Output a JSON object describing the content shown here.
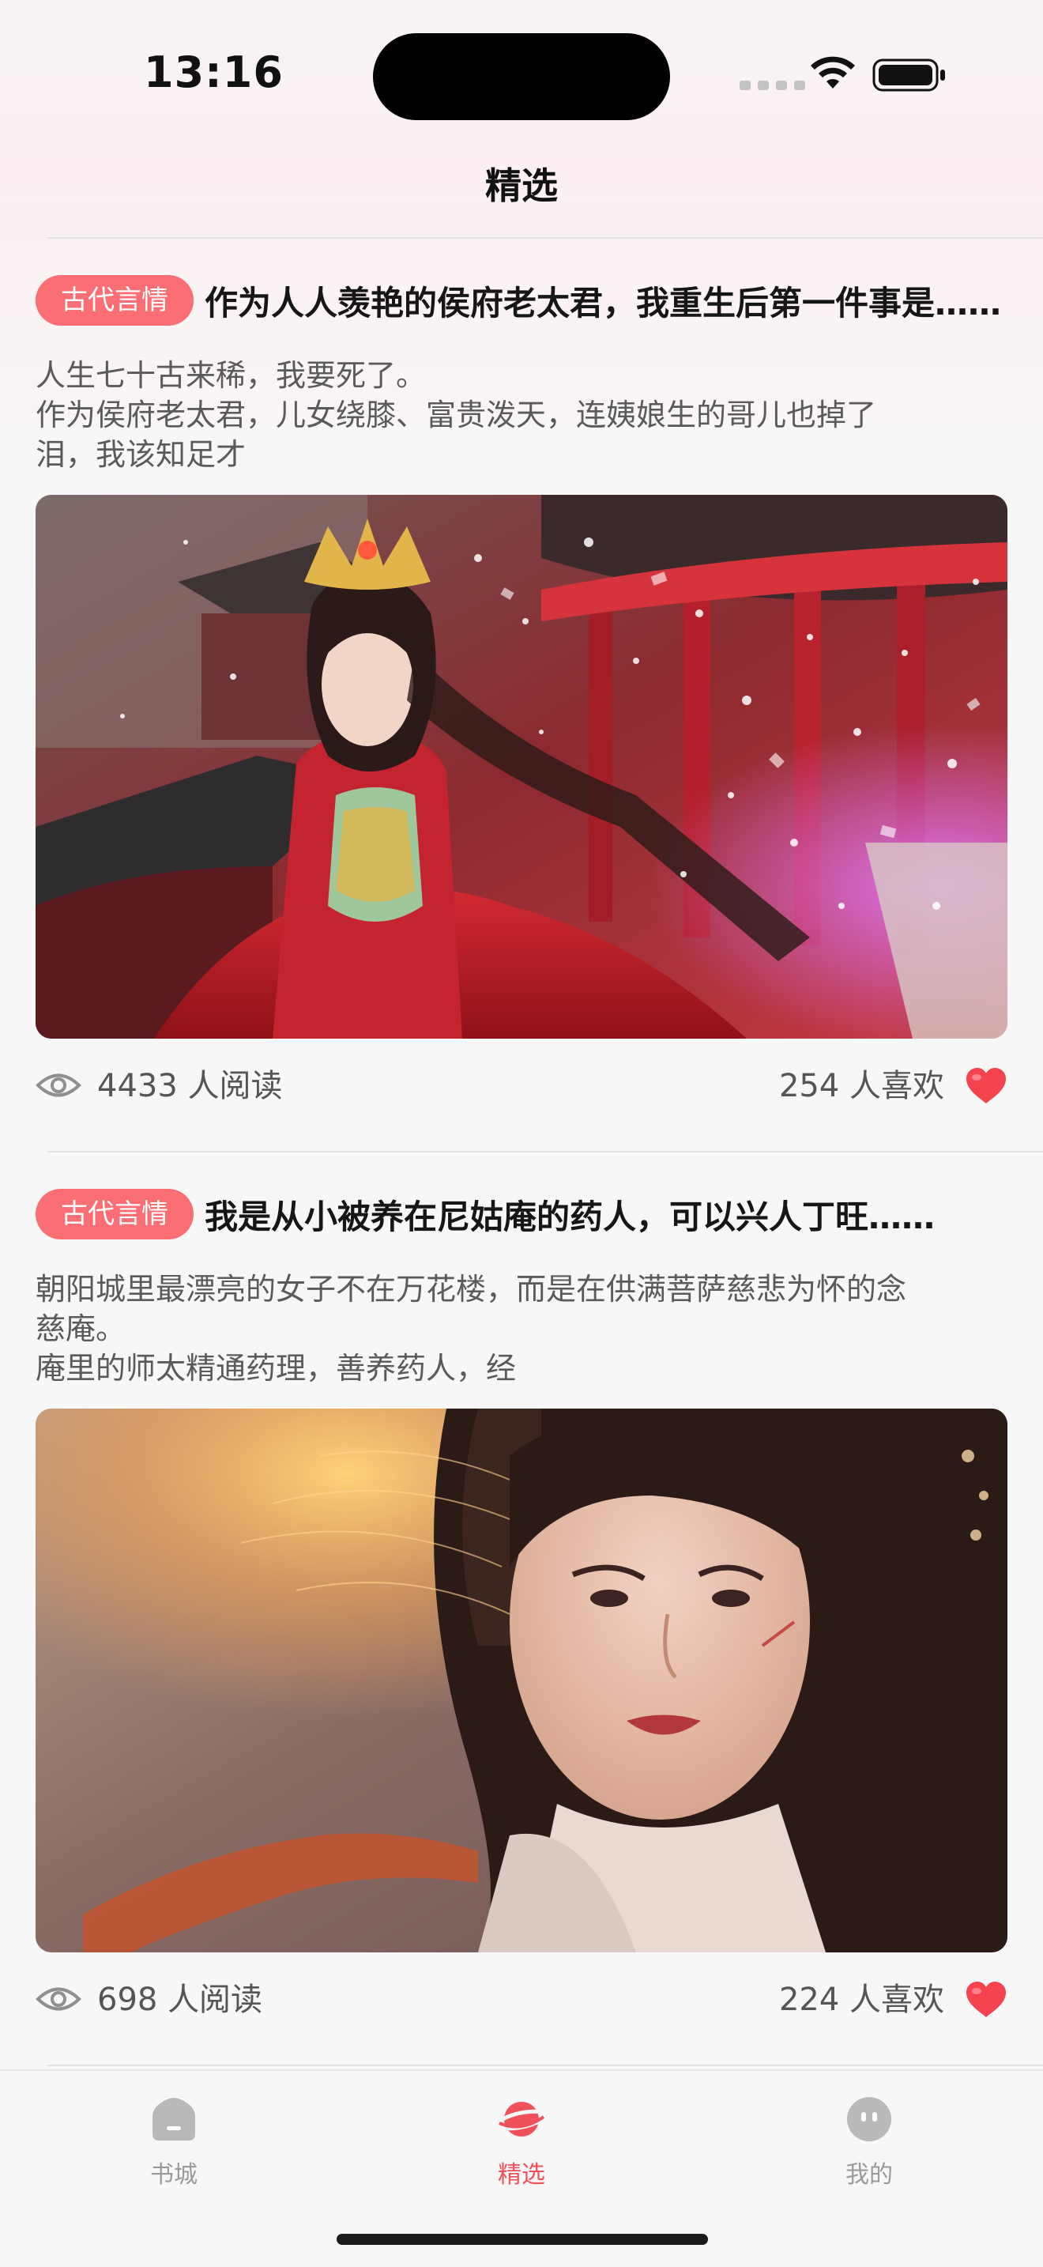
{
  "status_bar": {
    "time": "13:16"
  },
  "header": {
    "title": "精选"
  },
  "feed": [
    {
      "tag": "古代言情",
      "title": "作为人人羡艳的侯府老太君，我重生后第一件事是……",
      "summary_lines": [
        "人生七十古来稀，我要死了。",
        "作为侯府老太君，儿女绕膝、富贵泼天，连姨娘生的哥儿也掉了",
        "泪，我该知足才"
      ],
      "reads": "4433 人阅读",
      "likes": "254 人喜欢"
    },
    {
      "tag": "古代言情",
      "title": "我是从小被养在尼姑庵的药人，可以兴人丁旺……",
      "summary_lines": [
        "朝阳城里最漂亮的女子不在万花楼，而是在供满菩萨慈悲为怀的念",
        "慈庵。",
        "庵里的师太精通药理，善养药人，经"
      ],
      "reads": "698 人阅读",
      "likes": "224 人喜欢"
    }
  ],
  "tab_bar": {
    "items": [
      {
        "label": "书城",
        "icon": "bookstore-icon",
        "active": false
      },
      {
        "label": "精选",
        "icon": "planet-icon",
        "active": true
      },
      {
        "label": "我的",
        "icon": "profile-face-icon",
        "active": false
      }
    ]
  },
  "colors": {
    "accent": "#f0505a",
    "tag_background": "#fb6e74",
    "heart": "#f4434f"
  }
}
